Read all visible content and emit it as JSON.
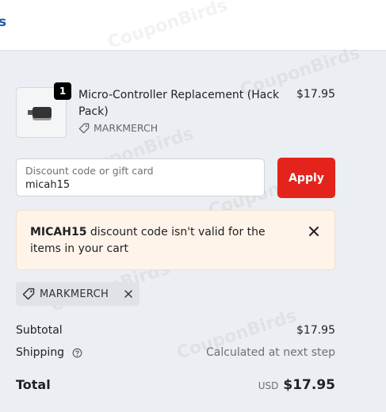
{
  "header": {
    "crumb_fragment": "s"
  },
  "product": {
    "quantity": "1",
    "name": "Micro-Controller Replacement (Hack Pack)",
    "discount_tag": "MARKMERCH",
    "price": "$17.95"
  },
  "discount": {
    "label": "Discount code or gift card",
    "value": "micah15",
    "apply_label": "Apply"
  },
  "alert": {
    "code": "MICAH15",
    "message": " discount code isn't valid for the items in your cart"
  },
  "applied_code": {
    "label": "MARKMERCH"
  },
  "summary": {
    "subtotal_label": "Subtotal",
    "subtotal_value": "$17.95",
    "shipping_label": "Shipping",
    "shipping_value": "Calculated at next step",
    "total_label": "Total",
    "currency": "USD",
    "total_value": "$17.95"
  },
  "watermark": "CouponBirds",
  "colors": {
    "apply": "#e4241c",
    "alert_bg": "#fef4ea",
    "page_bg": "#ebeef2"
  },
  "icons": [
    "tag-icon",
    "close-icon",
    "help-icon"
  ]
}
